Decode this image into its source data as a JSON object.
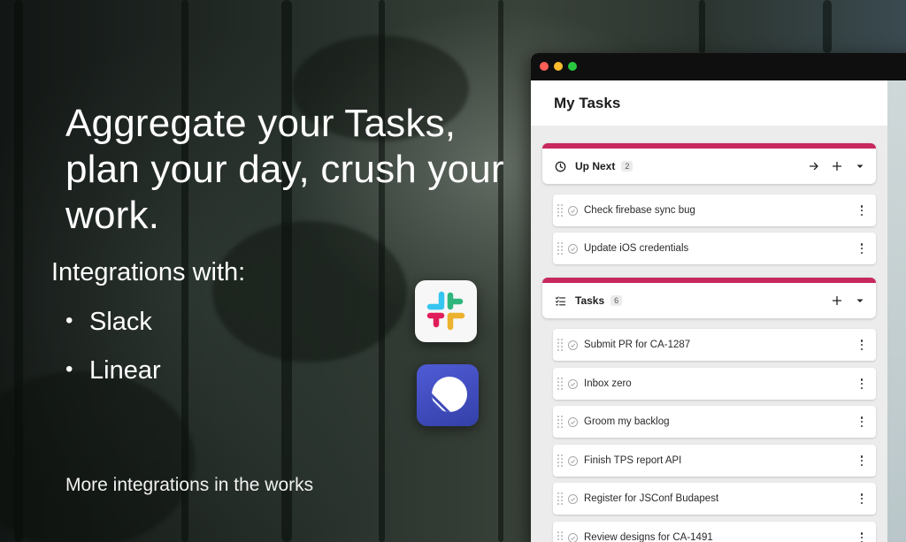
{
  "hero": {
    "title": "Aggregate your Tasks, plan your day, crush your work."
  },
  "integrations": {
    "heading": "Integrations with:",
    "items": [
      {
        "label": "Slack",
        "icon": "slack-logo-icon"
      },
      {
        "label": "Linear",
        "icon": "linear-logo-icon"
      }
    ],
    "more": "More integrations in the works"
  },
  "colors": {
    "accent": "#c8285f",
    "linear_brand": "#3d48b8",
    "slack_blue": "#36c5f0",
    "slack_green": "#2eb67d",
    "slack_red": "#e01e5a",
    "slack_yellow": "#ecb22e"
  },
  "app": {
    "header_title": "My Tasks",
    "sections": [
      {
        "label": "Up Next",
        "count": "2",
        "icon": "clock-icon",
        "actions": [
          "arrow-right-icon",
          "plus-icon",
          "caret-down-icon"
        ],
        "tasks": [
          "Check firebase sync bug",
          "Update iOS credentials"
        ]
      },
      {
        "label": "Tasks",
        "count": "6",
        "icon": "checklist-icon",
        "actions": [
          "plus-icon",
          "caret-down-icon"
        ],
        "tasks": [
          "Submit PR for CA-1287",
          "Inbox zero",
          "Groom my backlog",
          "Finish TPS report API",
          "Register for JSConf Budapest",
          "Review designs for CA-1491"
        ]
      }
    ]
  }
}
